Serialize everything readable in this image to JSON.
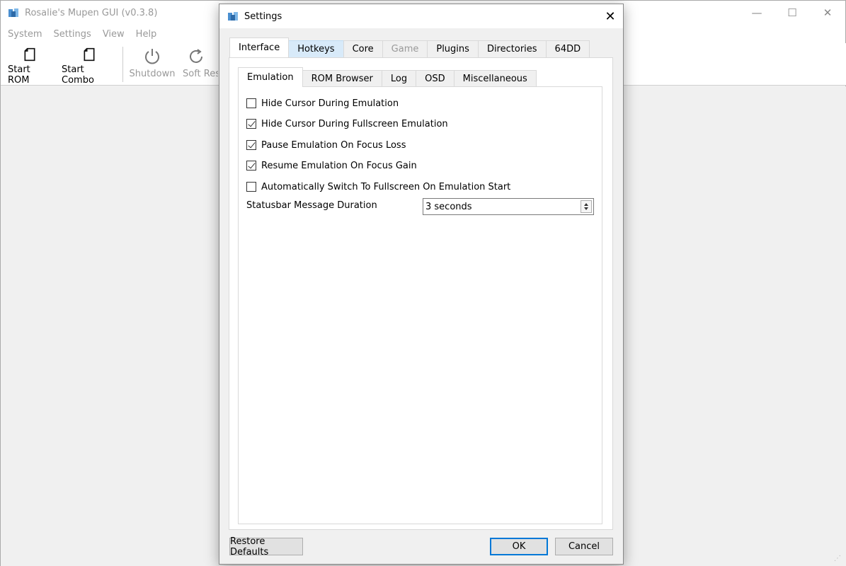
{
  "main_window": {
    "title": "Rosalie's Mupen GUI (v0.3.8)",
    "menu": [
      "System",
      "Settings",
      "View",
      "Help"
    ],
    "toolbar": {
      "start_rom": "Start ROM",
      "start_combo": "Start Combo",
      "shutdown": "Shutdown",
      "soft_reset": "Soft Rese"
    }
  },
  "dialog": {
    "title": "Settings",
    "outer_tabs": [
      "Interface",
      "Hotkeys",
      "Core",
      "Game",
      "Plugins",
      "Directories",
      "64DD"
    ],
    "inner_tabs": [
      "Emulation",
      "ROM Browser",
      "Log",
      "OSD",
      "Miscellaneous"
    ],
    "options": [
      {
        "label": "Hide Cursor During Emulation",
        "checked": false
      },
      {
        "label": "Hide Cursor During Fullscreen Emulation",
        "checked": true
      },
      {
        "label": "Pause Emulation On Focus Loss",
        "checked": true
      },
      {
        "label": "Resume Emulation On Focus Gain",
        "checked": true
      },
      {
        "label": "Automatically Switch To Fullscreen On Emulation Start",
        "checked": false
      }
    ],
    "statusbar_duration": {
      "label": "Statusbar Message Duration",
      "value": "3 seconds"
    },
    "buttons": {
      "restore_defaults": "Restore Defaults",
      "ok": "OK",
      "cancel": "Cancel"
    }
  },
  "colors": {
    "accent": "#0078d7",
    "hover_tab": "#d8eaf9"
  }
}
